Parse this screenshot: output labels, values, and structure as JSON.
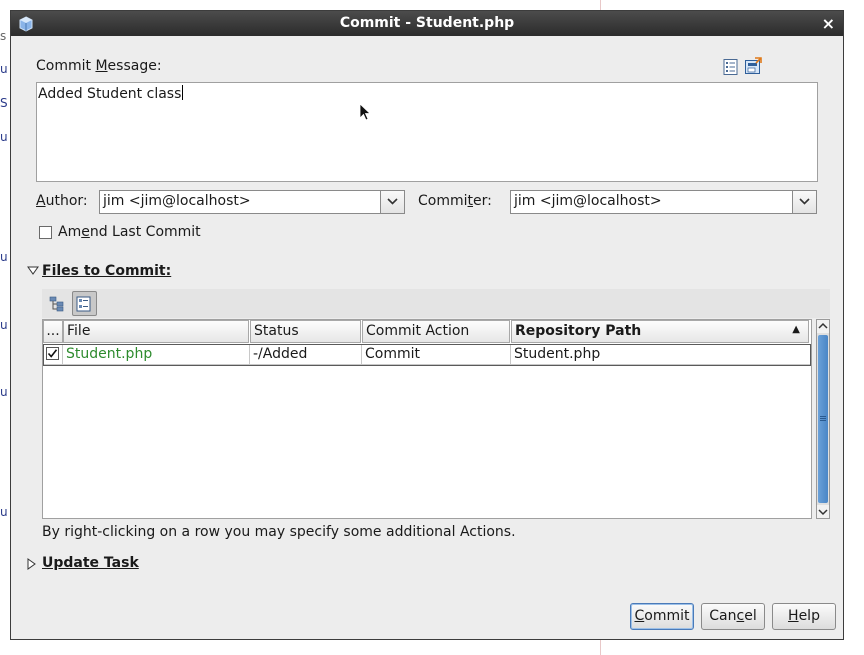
{
  "background": {
    "fragments": [
      "s",
      "u",
      "S",
      "u",
      "u",
      "u",
      "u",
      "u"
    ]
  },
  "dialog": {
    "title": "Commit - Student.php",
    "close_glyph": "×"
  },
  "commit_message": {
    "label_pre": "Commit ",
    "label_mnemonic": "M",
    "label_post": "essage:",
    "value": "Added Student class"
  },
  "author": {
    "label_mnemonic": "A",
    "label_post": "uthor:",
    "value": "jim <jim@localhost>"
  },
  "committer": {
    "label_pre": "Commi",
    "label_mnemonic": "t",
    "label_post": "er:",
    "value": "jim <jim@localhost>"
  },
  "amend": {
    "label_pre": "Am",
    "label_mnemonic": "e",
    "label_post": "nd Last Commit",
    "checked": false
  },
  "files_section": {
    "header": "Files to Commit:",
    "expanded": true,
    "columns": [
      "...",
      "File",
      "Status",
      "Commit Action",
      "Repository Path"
    ],
    "sort_column": "Repository Path",
    "sort_indicator": "▲",
    "rows": [
      {
        "checked": true,
        "file": "Student.php",
        "status": "-/Added",
        "action": "Commit",
        "path": "Student.php"
      }
    ],
    "hint": "By right-clicking on a row you may specify some additional Actions.",
    "file_color": "#2e8b2e"
  },
  "update_task": {
    "header": "Update Task",
    "expanded": false
  },
  "buttons": {
    "commit": {
      "pre": "",
      "mnemonic": "C",
      "post": "ommit"
    },
    "cancel": {
      "pre": "Can",
      "mnemonic": "c",
      "post": "el"
    },
    "help": {
      "pre": "",
      "mnemonic": "H",
      "post": "elp"
    }
  },
  "icons": [
    "app-icon",
    "close-icon",
    "template-icon",
    "recent-messages-icon",
    "chevron-down-icon",
    "checkbox-icon",
    "expand-triangle-icon",
    "tree-view-icon",
    "flat-view-icon",
    "sort-ascending-icon",
    "scroll-up-icon",
    "scroll-down-icon"
  ]
}
